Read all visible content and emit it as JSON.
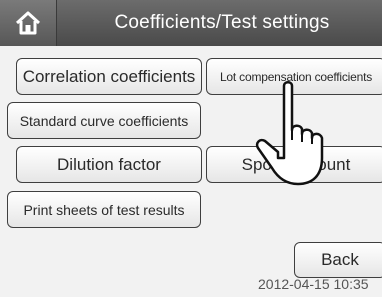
{
  "header": {
    "home_icon": "home-icon",
    "title": "Coefficients/Test settings"
  },
  "buttons": {
    "correlation": "Correlation coefficients",
    "lot_compensation": "Lot compensation coefficients",
    "standard_curve": "Standard curve coefficients",
    "dilution": "Dilution factor",
    "spotting_count": "Spotting count",
    "print_sheets": "Print sheets of test results",
    "back": "Back"
  },
  "footer": {
    "timestamp": "2012-04-15 10:35"
  },
  "overlay": {
    "pointer_icon": "pointing-hand-icon"
  },
  "colors": {
    "topbar": "#555555",
    "button_border": "#3f3f3f",
    "background": "#f2f2f2"
  }
}
